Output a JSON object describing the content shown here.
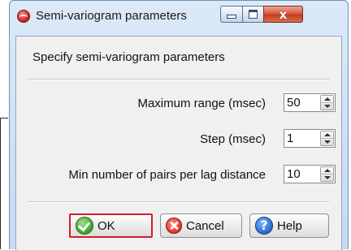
{
  "window": {
    "title": "Semi-variogram parameters",
    "close_glyph": "x"
  },
  "dialog": {
    "heading": "Specify semi-variogram parameters",
    "fields": [
      {
        "label": "Maximum range (msec)",
        "value": "50"
      },
      {
        "label": "Step (msec)",
        "value": "1"
      },
      {
        "label": "Min number of pairs per lag distance",
        "value": "10"
      }
    ]
  },
  "buttons": {
    "ok": "OK",
    "cancel": "Cancel",
    "help": "Help",
    "help_glyph": "?"
  },
  "colors": {
    "ok_highlight": "#d11f2c",
    "titlebar": "#c6daf0",
    "close_button": "#d8553d"
  },
  "icons": {
    "app": "app-icon",
    "ok": "checkmark-icon",
    "cancel": "cancel-x-icon",
    "help": "help-question-icon"
  }
}
